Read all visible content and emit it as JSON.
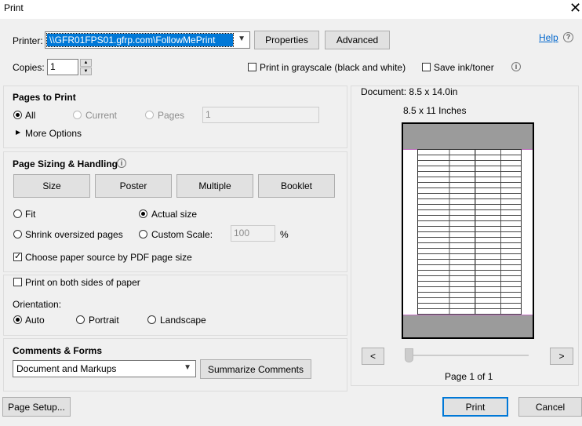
{
  "window": {
    "title": "Print",
    "close_glyph": "✕"
  },
  "printer": {
    "label": "Printer:",
    "selected": "\\\\GFR01FPS01.gfrp.com\\FollowMePrint",
    "properties_label": "Properties",
    "advanced_label": "Advanced",
    "help_label": "Help"
  },
  "copies": {
    "label": "Copies:",
    "value": "1",
    "grayscale_label": "Print in grayscale (black and white)",
    "grayscale_checked": false,
    "save_ink_label": "Save ink/toner",
    "save_ink_checked": false
  },
  "pages_to_print": {
    "title": "Pages to Print",
    "all_label": "All",
    "current_label": "Current",
    "pages_label": "Pages",
    "pages_value": "1",
    "selected": "All",
    "more_options_label": "More Options"
  },
  "sizing": {
    "title": "Page Sizing & Handling",
    "buttons": [
      "Size",
      "Poster",
      "Multiple",
      "Booklet"
    ],
    "fit_label": "Fit",
    "actual_size_label": "Actual size",
    "shrink_label": "Shrink oversized pages",
    "custom_scale_label": "Custom Scale:",
    "custom_scale_value": "100",
    "percent_label": "%",
    "selected": "Actual size",
    "paper_source_label": "Choose paper source by PDF page size",
    "paper_source_checked": true
  },
  "duplex": {
    "both_sides_label": "Print on both sides of paper",
    "both_sides_checked": false,
    "orientation_label": "Orientation:",
    "auto_label": "Auto",
    "portrait_label": "Portrait",
    "landscape_label": "Landscape",
    "selected": "Auto"
  },
  "comments": {
    "title": "Comments & Forms",
    "selected": "Document and Markups",
    "summarize_label": "Summarize Comments"
  },
  "preview": {
    "document_size": "Document: 8.5 x 14.0in",
    "paper_size": "8.5 x 11 Inches",
    "prev_label": "<",
    "next_label": ">",
    "page_indicator": "Page 1 of 1"
  },
  "footer": {
    "page_setup_label": "Page Setup...",
    "print_label": "Print",
    "cancel_label": "Cancel"
  },
  "colors": {
    "accent": "#0078d7",
    "highlight": "#0078d7",
    "link": "#0066cc"
  }
}
